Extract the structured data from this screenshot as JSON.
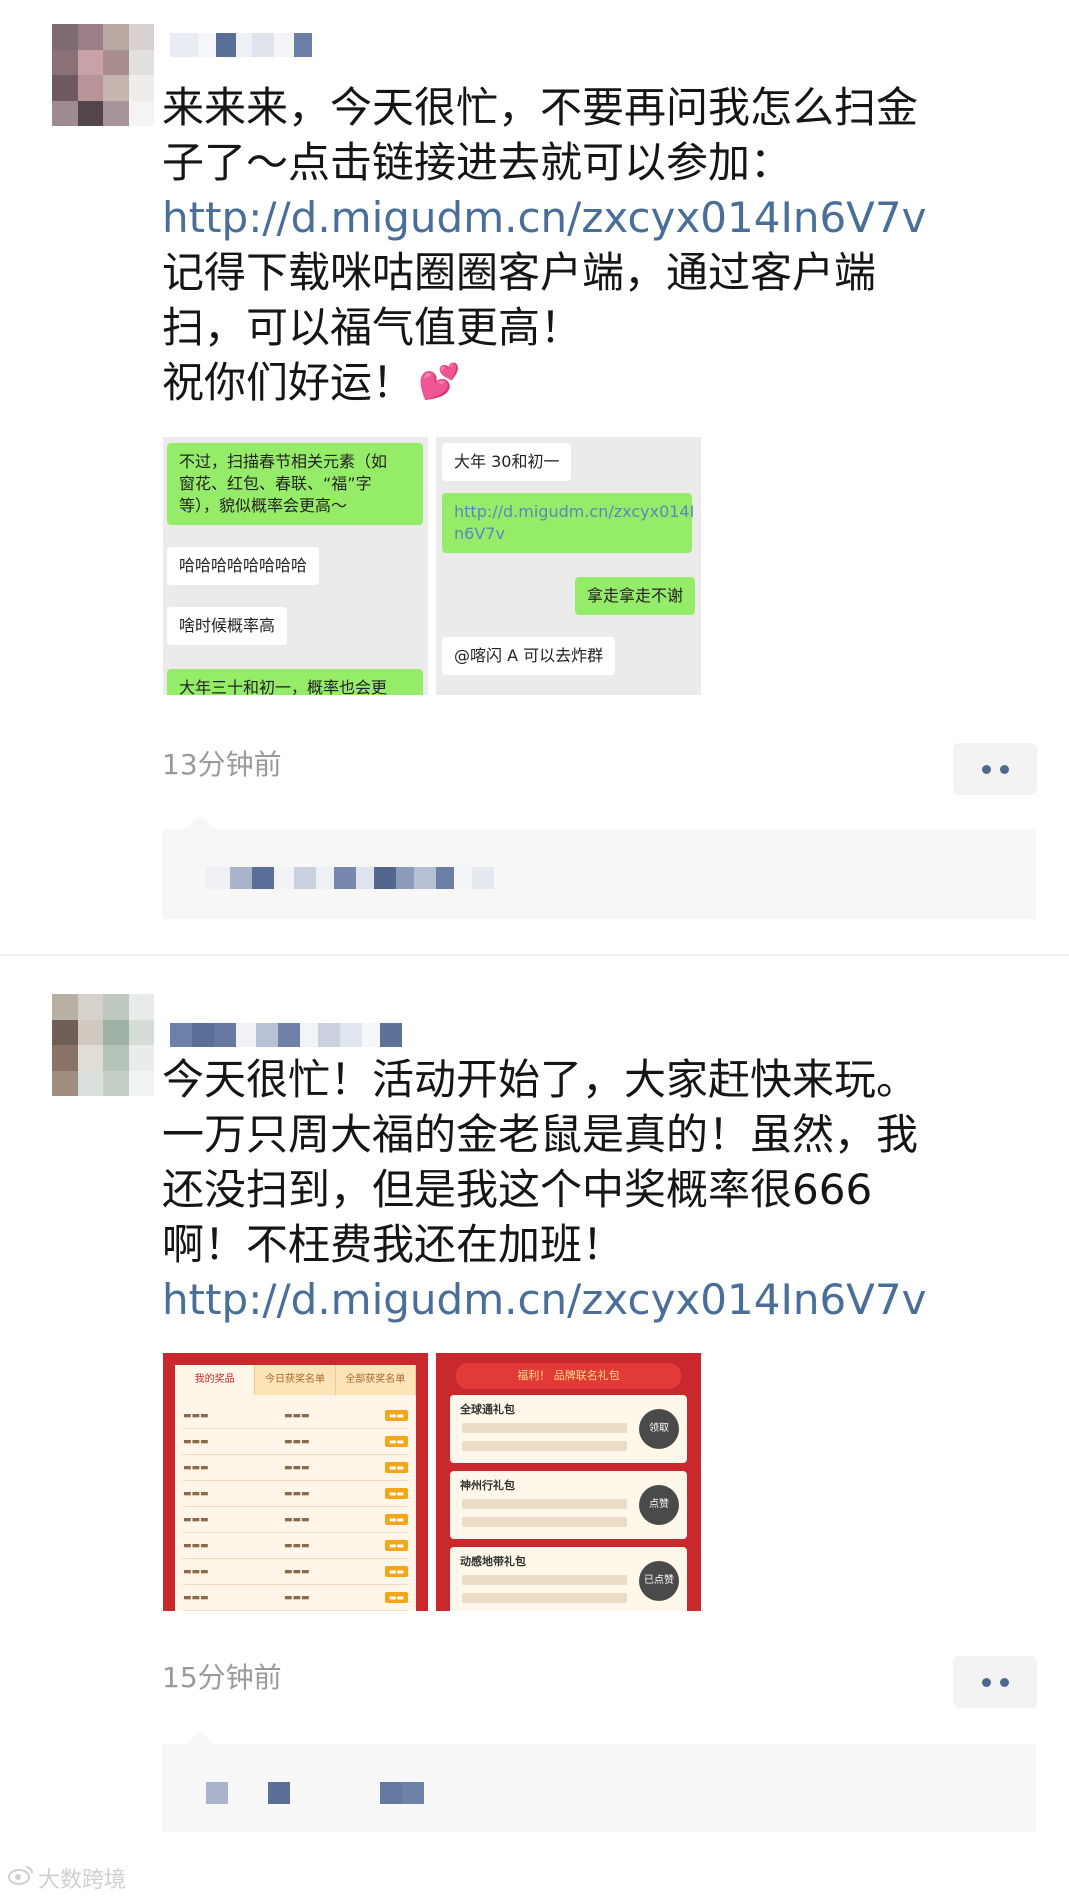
{
  "posts": [
    {
      "text_lines": [
        "来来来，今天很忙，不要再问我怎么扫金",
        "子了～点击链接进去就可以参加："
      ],
      "link": "http://d.migudm.cn/zxcyx014In6V7v",
      "text_lines_after": [
        "记得下载咪咕圈圈客户端，通过客户端",
        "扫，可以福气值更高！",
        "祝你们好运！"
      ],
      "emoji": "💕",
      "images": [
        {
          "bubbles": [
            "不过，扫描春节相关元素（如",
            "窗花、红包、春联、“福”字",
            "等），貌似概率会更高～",
            "哈哈哈哈哈哈哈哈",
            "啥时候概率高",
            "大年三十和初一，概率也会更"
          ]
        },
        {
          "bubbles": [
            "大年 30和初一",
            "http://d.migudm.cn/zxcyx014I",
            "n6V7v",
            "拿走拿走不谢",
            "@喀闪 A 可以去炸群"
          ]
        }
      ],
      "time": "13分钟前"
    },
    {
      "text_lines": [
        "今天很忙！活动开始了，大家赶快来玩。",
        "一万只周大福的金老鼠是真的！虽然，我",
        "还没扫到，但是我这个中奖概率很666",
        "啊！不枉费我还在加班！"
      ],
      "link": "http://d.migudm.cn/zxcyx014In6V7v",
      "images": [
        {
          "tabs": [
            "我的奖品",
            "今日获奖名单",
            "全部获奖名单"
          ]
        },
        {
          "header": "福利！ 品牌联名礼包",
          "gifts": [
            {
              "title": "全球通礼包",
              "button": "领取"
            },
            {
              "title": "神州行礼包",
              "button": "点赞"
            },
            {
              "title": "动感地带礼包",
              "button": "已点赞"
            }
          ]
        }
      ],
      "time": "15分钟前"
    }
  ],
  "watermark": "大数跨境",
  "colors": {
    "link": "#4a6e9a",
    "time": "#9a9a9a",
    "more_dots": "#4f6890",
    "chat_green": "#95ec69",
    "app_red": "#c9282d"
  },
  "icons": {
    "more": "more-dots-icon",
    "watermark_logo": "weibo-logo-icon"
  }
}
